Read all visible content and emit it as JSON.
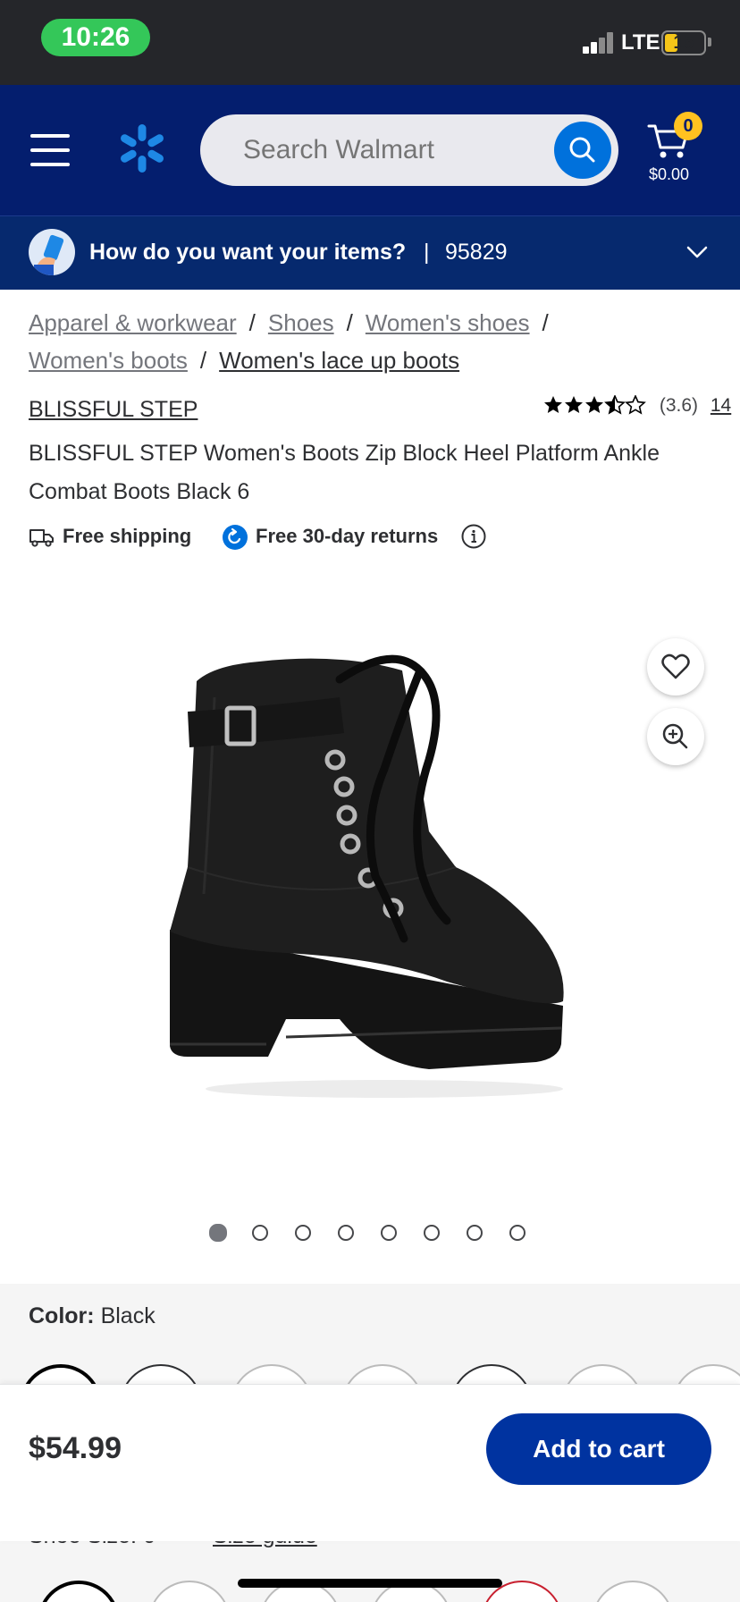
{
  "status_bar": {
    "time": "10:26",
    "network": "LTE",
    "battery": "15"
  },
  "header": {
    "search_placeholder": "Search Walmart",
    "cart_count": "0",
    "cart_total": "$0.00"
  },
  "delivery": {
    "question": "How do you want your items?",
    "separator": "|",
    "zip": "95829"
  },
  "breadcrumbs": [
    "Apparel & workwear",
    "Shoes",
    "Women's shoes",
    "Women's boots",
    "Women's lace up boots"
  ],
  "product": {
    "brand": "BLISSFUL STEP",
    "rating": 3.6,
    "rating_text": "(3.6)",
    "review_count": "14",
    "title": "BLISSFUL STEP Women's Boots Zip Block Heel Platform Ankle Combat Boots Black 6",
    "perks": [
      "Free shipping",
      "Free 30-day returns"
    ],
    "image_count": 8,
    "image_index": 0
  },
  "color": {
    "label": "Color:",
    "value": "Black"
  },
  "size": {
    "label": "Shoe Size: 6",
    "guide": "Size guide"
  },
  "sticky": {
    "price": "$54.99",
    "add_to_cart": "Add to cart"
  },
  "colors": {
    "walmart_blue": "#041e6e",
    "spark_blue": "#1e88e5",
    "button_blue": "#0033a0",
    "badge_yellow": "#ffc220",
    "status_green": "#34c759"
  }
}
